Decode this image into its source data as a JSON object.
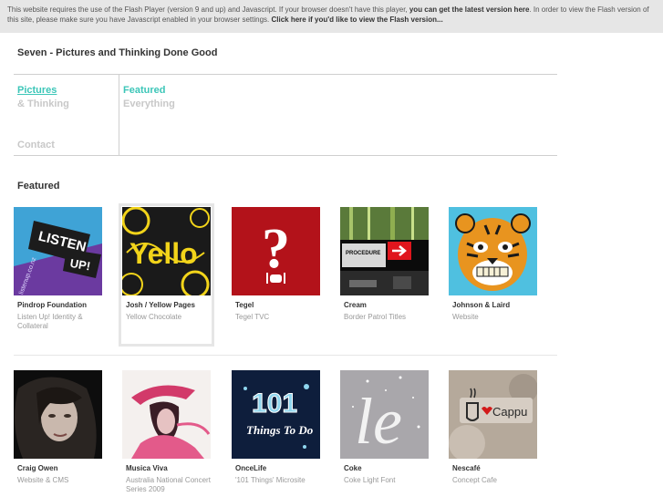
{
  "flash_notice": {
    "text_1": "This website requires the use of the Flash Player (version 9 and up) and Javascript. If your browser doesn't have this player, ",
    "link_1": "you can get the latest version here",
    "text_2": ". In order to view the Flash version of this site, please make sure you have Javascript enabled in your browser settings. ",
    "link_2": "Click here if you'd like to view the Flash version..."
  },
  "site": {
    "title": "Seven - Pictures and Thinking Done Good"
  },
  "nav": {
    "left": {
      "item1": "Pictures",
      "item2": "& Thinking",
      "contact": "Contact"
    },
    "right": {
      "item1": "Featured",
      "item2": "Everything"
    }
  },
  "featured": {
    "heading": "Featured",
    "items": [
      {
        "name": "Pindrop Foundation",
        "desc": "Listen Up! Identity & Collateral"
      },
      {
        "name": "Josh / Yellow Pages",
        "desc": "Yellow Chocolate"
      },
      {
        "name": "Tegel",
        "desc": "Tegel TVC"
      },
      {
        "name": "Cream",
        "desc": "Border Patrol Titles"
      },
      {
        "name": "Johnson & Laird",
        "desc": "Website"
      },
      {
        "name": "Craig Owen",
        "desc": "Website & CMS"
      },
      {
        "name": "Musica Viva",
        "desc": "Australia National Concert Series 2009"
      },
      {
        "name": "OnceLife",
        "desc": "'101 Things' Microsite"
      },
      {
        "name": "Coke",
        "desc": "Coke Light Font"
      },
      {
        "name": "Nescafé",
        "desc": "Concept Cafe"
      }
    ]
  },
  "thumb_text": {
    "listen": "LISTEN",
    "up": "UP!",
    "url": "listenup.co.nz",
    "yello": "Yello",
    "question": "?",
    "procedure": "PROCEDURE",
    "num101": "101",
    "things": "Things To Do",
    "coke": "le",
    "cappu": "Cappu"
  }
}
